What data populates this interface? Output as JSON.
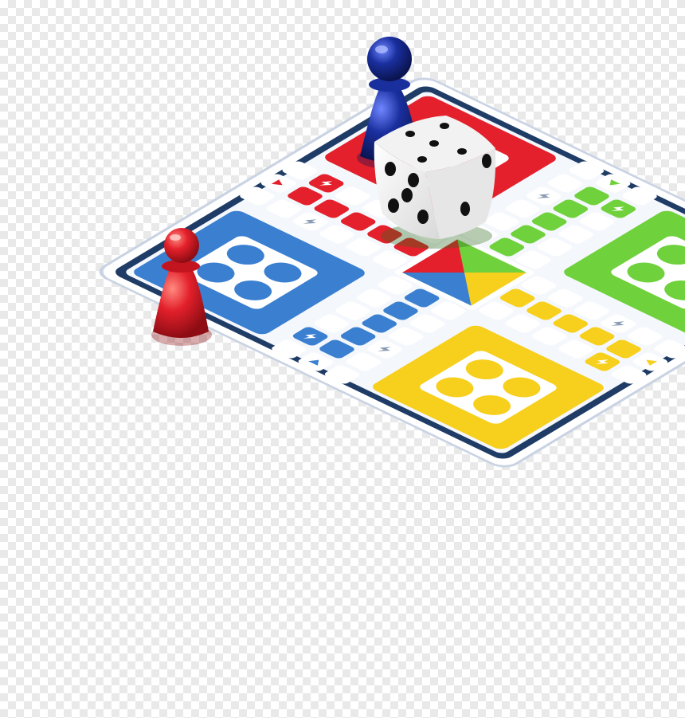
{
  "game": {
    "board": {
      "colors": {
        "red": "#e3202b",
        "green": "#6fd13b",
        "yellow": "#f7cf1d",
        "blue": "#3a7fd0",
        "frame": "#1f3c66",
        "frame_light": "#f4f7fc",
        "cell": "#ffffff",
        "arrow_icon_color": "#8a9cb3",
        "star_icon": "lightning-bolt-icon"
      },
      "home_bases": [
        {
          "color": "red",
          "dots": 4
        },
        {
          "color": "green",
          "dots": 4
        },
        {
          "color": "yellow",
          "dots": 4
        },
        {
          "color": "blue",
          "dots": 4
        }
      ],
      "center_triangles": [
        "green",
        "yellow",
        "blue",
        "red"
      ]
    },
    "pieces": [
      {
        "color": "blue",
        "piece": "pawn"
      },
      {
        "color": "red",
        "piece": "pawn"
      }
    ],
    "dice": {
      "top_face": 5,
      "front_face": 5,
      "side_face": 2
    }
  }
}
